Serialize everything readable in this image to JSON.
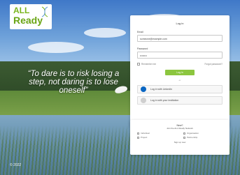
{
  "logo": {
    "line1": "ALL",
    "line2": "Ready",
    "brand_color": "#7ab51d"
  },
  "quote": {
    "text": "“To dare is to risk losing a step, not daring is to lose oneself”"
  },
  "copyright": "© 2022",
  "login": {
    "title": "Log in",
    "email_label": "Email",
    "email_value": "someone@example.com",
    "password_label": "Password",
    "password_value": "••••••••",
    "remember_label": "Remember me",
    "forgot_label": "Forgot password?",
    "login_button": "Log in",
    "divider": "or",
    "sso_linkedin": "Log in with LinkedIn",
    "sso_other": "Log in with your institution",
    "accent": "#8cc63f"
  },
  "signup": {
    "title": "New?",
    "subtitle": "Join the ALL Ready Network",
    "options": [
      "Individual",
      "Organisation",
      "Project",
      "Partnership"
    ],
    "footer": "Sign up now"
  }
}
